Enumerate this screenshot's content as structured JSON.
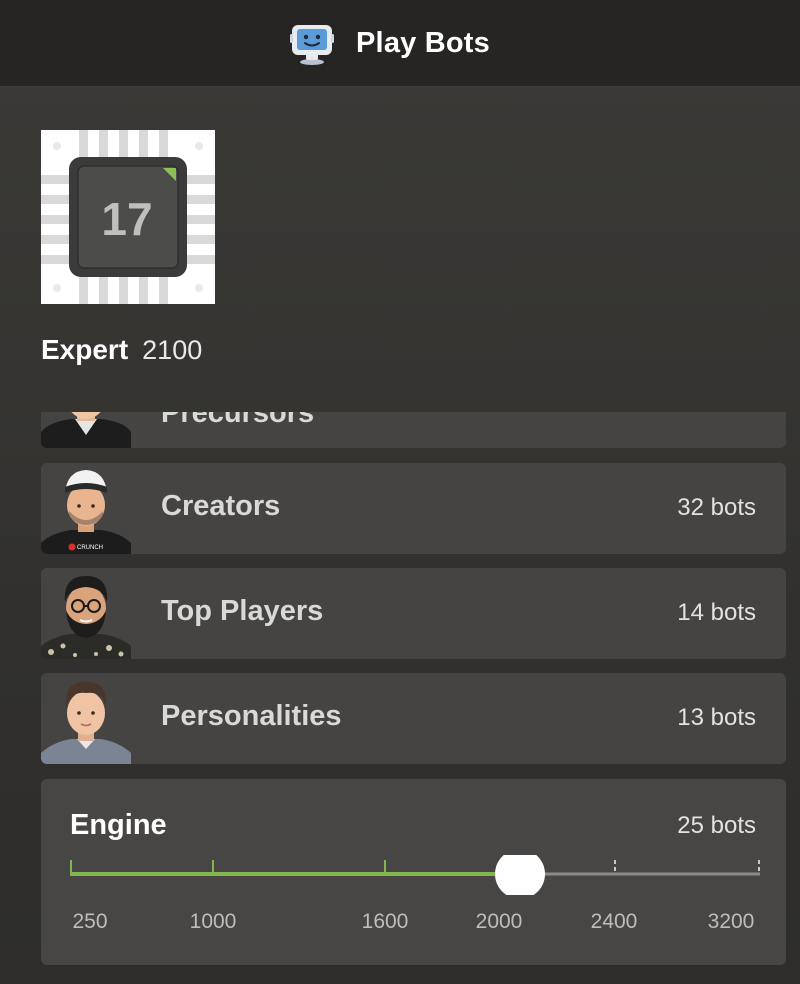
{
  "header": {
    "title": "Play Bots",
    "icon": "robot-icon"
  },
  "selected_bot": {
    "chip_number": "17",
    "level_name": "Expert",
    "rating": "2100"
  },
  "categories": [
    {
      "label": "Precursors",
      "count": "",
      "avatar": "avatar-man-icon"
    },
    {
      "label": "Creators",
      "count": "32 bots",
      "avatar": "avatar-creator-icon"
    },
    {
      "label": "Top Players",
      "count": "14 bots",
      "avatar": "avatar-bearded-icon"
    },
    {
      "label": "Personalities",
      "count": "13 bots",
      "avatar": "avatar-personality-icon"
    }
  ],
  "engine": {
    "title": "Engine",
    "count": "25 bots",
    "ticks": [
      "250",
      "1000",
      "1600",
      "2000",
      "2400",
      "3200"
    ],
    "selected": "2000",
    "accent": "#81b64c"
  }
}
